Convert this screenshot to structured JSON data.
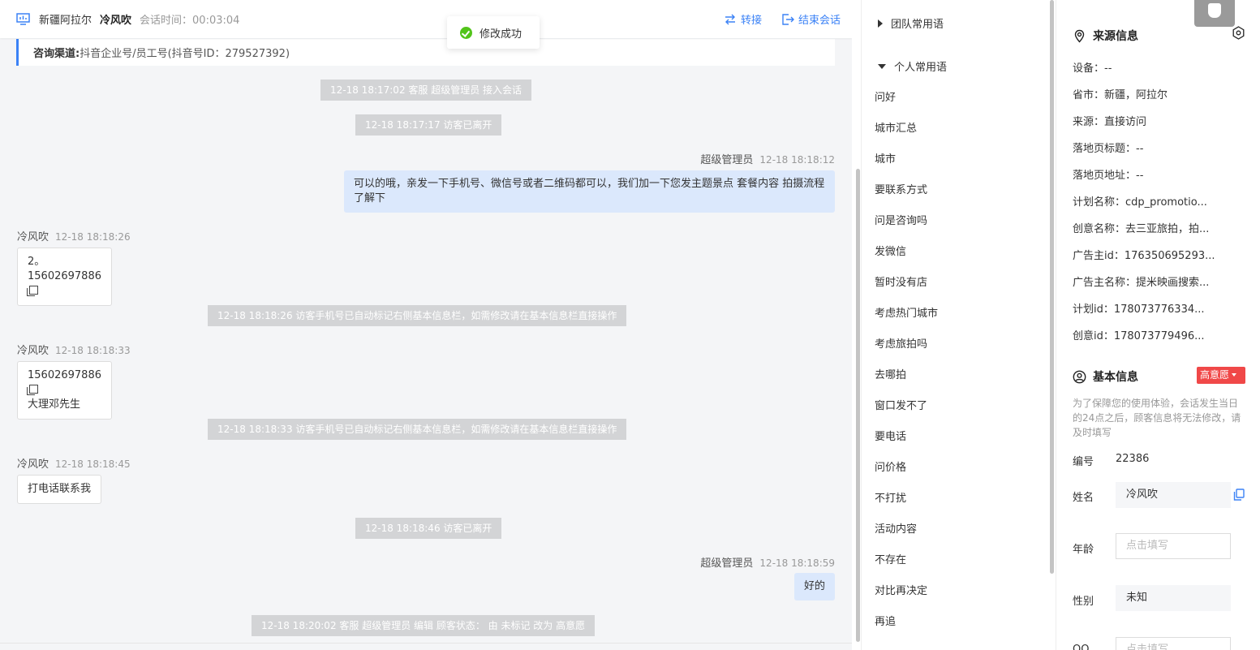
{
  "header": {
    "location": "新疆阿拉尔",
    "visitor_name": "冷风吹",
    "duration": "会话时间：00:03:04",
    "transfer_label": "转接",
    "end_label": "结束会话"
  },
  "channel": {
    "label": "咨询渠道:",
    "value": "抖音企业号/员工号(抖音号ID：279527392)"
  },
  "toast": "修改成功",
  "messages": {
    "sys1": "12-18 18:17:02 客服 超级管理员 接入会话",
    "sys2": "12-18 18:17:17 访客已离开",
    "agent1_who": "超级管理员",
    "agent1_time": "12-18 18:18:12",
    "agent1_text": "可以的哦，亲发一下手机号、微信号或者二维码都可以，我们加一下您发主题景点 套餐内容 拍摄流程了解下",
    "v1_who": "冷风吹",
    "v1_time": "12-18 18:18:26",
    "v1_line1": "2。",
    "v1_line2": "15602697886",
    "sys3": "12-18 18:18:26 访客手机号已自动标记右侧基本信息栏，如需修改请在基本信息栏直接操作",
    "v2_who": "冷风吹",
    "v2_time": "12-18 18:18:33",
    "v2_line1": "15602697886",
    "v2_line2": "大理邓先生",
    "sys4": "12-18 18:18:33 访客手机号已自动标记右侧基本信息栏，如需修改请在基本信息栏直接操作",
    "v3_who": "冷风吹",
    "v3_time": "12-18 18:18:45",
    "v3_text": "打电话联系我",
    "sys5": "12-18 18:18:46 访客已离开",
    "agent2_who": "超级管理员",
    "agent2_time": "12-18 18:18:59",
    "agent2_text": "好的",
    "sys6": "12-18 18:20:02 客服 超级管理员 编辑 顾客状态： 由 未标记 改为 高意愿"
  },
  "phrases": {
    "team_group": "团队常用语",
    "personal_group": "个人常用语",
    "items": [
      "问好",
      "城市汇总",
      "城市",
      "要联系方式",
      "问是咨询吗",
      "发微信",
      "暂时没有店",
      "考虑热门城市",
      "考虑旅拍吗",
      "去哪拍",
      "窗口发不了",
      "要电话",
      "问价格",
      "不打扰",
      "活动内容",
      "不存在",
      "对比再决定",
      "再追"
    ]
  },
  "source": {
    "title": "来源信息",
    "device": "设备：--",
    "province": "省市：新疆，阿拉尔",
    "origin": "来源：直接访问",
    "landing_title": "落地页标题：--",
    "landing_url": "落地页地址：--",
    "plan_name": "计划名称：cdp_promotio...",
    "creative_name": "创意名称：去三亚旅拍，拍...",
    "advertiser_id": "广告主id：176350695293...",
    "advertiser_name": "广告主名称：提米映画搜索...",
    "plan_id": "计划id：178073776334...",
    "creative_id": "创意id：178073779496..."
  },
  "basic": {
    "title": "基本信息",
    "intent": "高意愿",
    "notice": "为了保障您的使用体验，会话发生当日的24点之后，顾客信息将无法修改，请及时填写",
    "id_label": "编号",
    "id_value": "22386",
    "name_label": "姓名",
    "name_value": "冷风吹",
    "age_label": "年龄",
    "age_placeholder": "点击填写",
    "gender_label": "性别",
    "gender_value": "未知",
    "qq_label": "QQ",
    "qq_placeholder": "点击填写"
  },
  "colors": {
    "accent": "#3b82f6",
    "success": "#52c41a",
    "intent_red": "#f04848",
    "agent_bubble": "#dbe8fc"
  }
}
